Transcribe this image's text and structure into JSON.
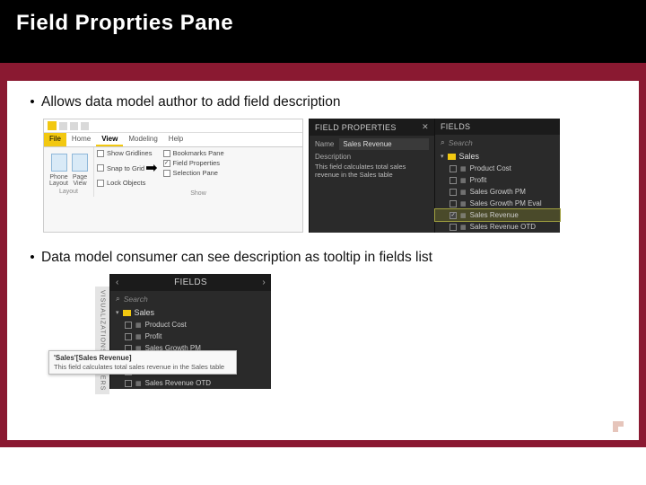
{
  "title": "Field Proprties Pane",
  "bullets": [
    "Allows data model author to add field description",
    "Data model consumer can see description as tooltip in fields list"
  ],
  "ribbon": {
    "tabs": {
      "file": "File",
      "home": "Home",
      "view": "View",
      "modeling": "Modeling",
      "help": "Help"
    },
    "group1": {
      "phone": "Phone\nLayout",
      "page": "Page\nView",
      "label": "Layout"
    },
    "show": {
      "gridlines": "Show Gridlines",
      "snap": "Snap to Grid",
      "lock": "Lock Objects",
      "bookmarks": "Bookmarks Pane",
      "fieldprops": "Field Properties",
      "selection": "Selection Pane",
      "label": "Show"
    }
  },
  "fieldprops": {
    "header": "FIELD PROPERTIES",
    "name_label": "Name",
    "name_value": "Sales Revenue",
    "desc_label": "Description",
    "desc_value": "This field calculates total sales revenue in the Sales table"
  },
  "fields": {
    "header": "FIELDS",
    "search": "Search",
    "table": "Sales",
    "items": [
      {
        "label": "Product Cost",
        "checked": false
      },
      {
        "label": "Profit",
        "checked": false
      },
      {
        "label": "Sales Growth PM",
        "checked": false
      },
      {
        "label": "Sales Growth PM Eval",
        "checked": false
      },
      {
        "label": "Sales Revenue",
        "checked": true,
        "selected": true
      },
      {
        "label": "Sales Revenue OTD",
        "checked": false
      }
    ]
  },
  "tooltip": {
    "title": "'Sales'[Sales Revenue]",
    "body": "This field calculates total sales revenue in the Sales table"
  },
  "sidebars": {
    "viz": "VISUALIZATIONS",
    "filters": "FILTERS"
  }
}
